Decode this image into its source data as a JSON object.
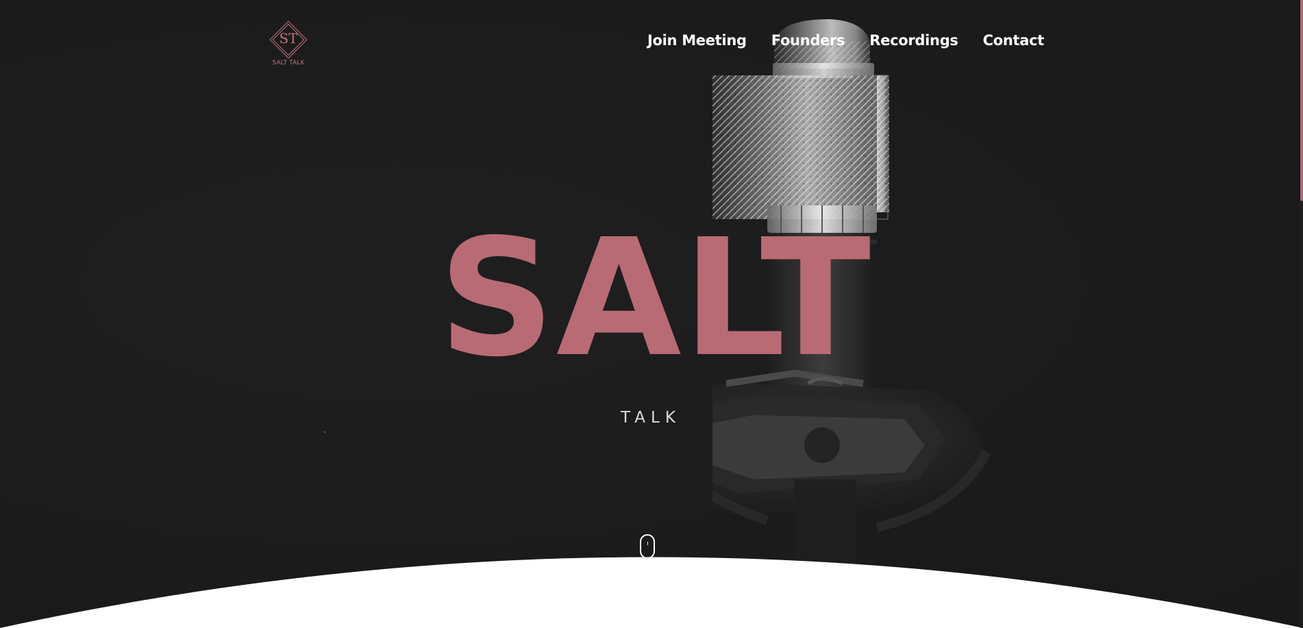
{
  "logo": {
    "monogram": "ST",
    "caption": "SALT TALK"
  },
  "nav": {
    "items": [
      {
        "label": "Join Meeting"
      },
      {
        "label": "Founders"
      },
      {
        "label": "Recordings"
      },
      {
        "label": "Contact"
      }
    ]
  },
  "hero": {
    "title": "SALT",
    "subtitle": "TALK"
  },
  "icons": {
    "background": "microphone-illustration",
    "scroll": "mouse-scroll-icon"
  },
  "colors": {
    "background": "#1c1c1d",
    "accent": "#b96b75",
    "nav_text": "#ffffff",
    "subtitle": "#dddddd",
    "section_bg": "#ffffff"
  },
  "scrollbar": {
    "position_fraction": 0.0,
    "visible_fraction": 0.32
  }
}
